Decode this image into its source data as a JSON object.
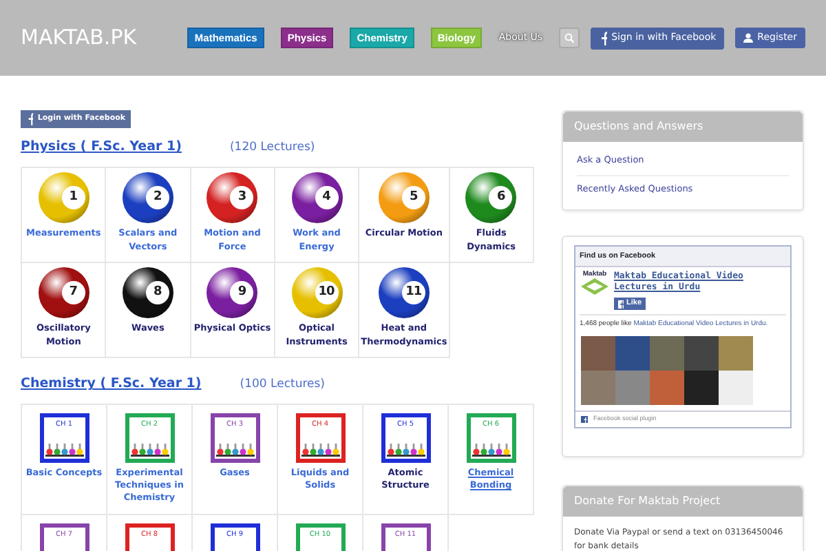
{
  "site_title": "MAKTAB.PK",
  "nav": [
    {
      "label": "Mathematics",
      "kind": "pill",
      "color": "#1a72bd"
    },
    {
      "label": "Physics",
      "kind": "pill",
      "color": "#8b2f8b"
    },
    {
      "label": "Chemistry",
      "kind": "pill",
      "color": "#1ba8a8"
    },
    {
      "label": "Biology",
      "kind": "pill",
      "color": "#8cc63e"
    },
    {
      "label": "About Us",
      "kind": "link"
    }
  ],
  "header_buttons": [
    {
      "label": "Sign in with Facebook",
      "kind": "facebook"
    },
    {
      "label": "Register",
      "kind": "register"
    }
  ],
  "login_button": "Login with Facebook",
  "sections": [
    {
      "title": "Physics ( F.Sc. Year 1)",
      "count": "(120 Lectures)",
      "kind": "balls",
      "items": [
        {
          "number": "1",
          "label": "Measurements",
          "color": "#e6c000",
          "visited": false,
          "hovered": false
        },
        {
          "number": "2",
          "label": "Scalars and Vectors",
          "color": "#1c3fc0",
          "visited": false,
          "hovered": false
        },
        {
          "number": "3",
          "label": "Motion and Force",
          "color": "#d42222",
          "visited": false,
          "hovered": false
        },
        {
          "number": "4",
          "label": "Work and Energy",
          "color": "#7a1fa0",
          "visited": false,
          "hovered": false
        },
        {
          "number": "5",
          "label": "Circular Motion",
          "color": "#f39c12",
          "visited": true,
          "hovered": false
        },
        {
          "number": "6",
          "label": "Fluids Dynamics",
          "color": "#1e8a1e",
          "visited": true,
          "hovered": false
        },
        {
          "number": "7",
          "label": "Oscillatory Motion",
          "color": "#a01010",
          "visited": true,
          "hovered": false
        },
        {
          "number": "8",
          "label": "Waves",
          "color": "#111111",
          "visited": true,
          "hovered": false
        },
        {
          "number": "9",
          "label": "Physical Optics",
          "color": "#7a1fa0",
          "visited": true,
          "hovered": false
        },
        {
          "number": "10",
          "label": "Optical Instruments",
          "color": "#e6c000",
          "visited": true,
          "hovered": false
        },
        {
          "number": "11",
          "label": "Heat and Thermodynamics",
          "color": "#1c3fc0",
          "visited": true,
          "hovered": false
        }
      ]
    },
    {
      "title": "Chemistry ( F.Sc. Year 1)",
      "count": "(100 Lectures)",
      "kind": "frames",
      "items": [
        {
          "number": "CH 1",
          "label": "Basic Concepts",
          "color": "#1f2fd8",
          "visited": false,
          "hovered": false
        },
        {
          "number": "CH 2",
          "label": "Experimental Techniques in Chemistry",
          "color": "#22aa55",
          "visited": false,
          "hovered": false
        },
        {
          "number": "CH 3",
          "label": "Gases",
          "color": "#8844aa",
          "visited": false,
          "hovered": false
        },
        {
          "number": "CH 4",
          "label": "Liquids and Solids",
          "color": "#dd2222",
          "visited": false,
          "hovered": false
        },
        {
          "number": "CH 5",
          "label": "Atomic Structure",
          "color": "#1f2fd8",
          "visited": true,
          "hovered": false
        },
        {
          "number": "CH 6",
          "label": "Chemical Bonding",
          "color": "#22aa55",
          "visited": false,
          "hovered": true
        },
        {
          "number": "CH 7",
          "color": "#8844aa"
        },
        {
          "number": "CH 8",
          "color": "#dd2222"
        },
        {
          "number": "CH 9",
          "color": "#1f2fd8"
        },
        {
          "number": "CH 10",
          "color": "#22aa55"
        },
        {
          "number": "CH 11",
          "color": "#8844aa"
        }
      ]
    }
  ],
  "qa_panel": {
    "title": "Questions and Answers",
    "links": [
      "Ask a Question",
      "Recently Asked Questions"
    ]
  },
  "facebook_box": {
    "header": "Find us on Facebook",
    "page_name": "Maktab Educational Video Lectures in Urdu",
    "logo_text": "Maktab",
    "like_button": "Like",
    "likes_text": "1,468 people like",
    "likes_link": "Maktab Educational Video Lectures in Urdu.",
    "footer": "Facebook social plugin"
  },
  "donate_panel": {
    "title": "Donate For Maktab Project",
    "text": "Donate Via Paypal or send a text on 03136450046 for bank details"
  }
}
